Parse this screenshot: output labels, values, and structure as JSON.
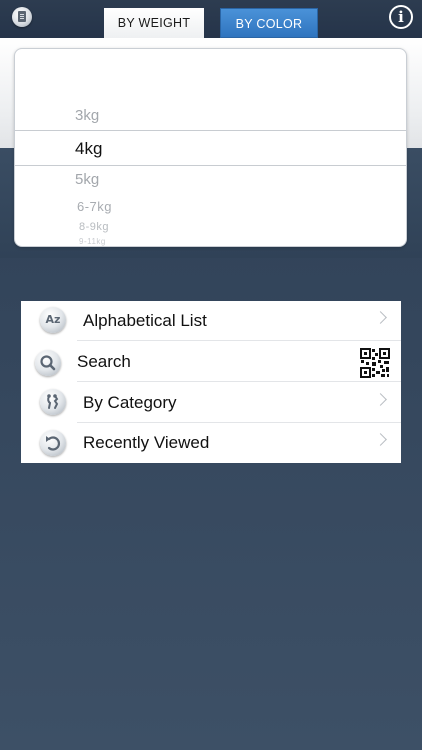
{
  "header": {
    "tabs": [
      {
        "label": "BY WEIGHT",
        "active": true
      },
      {
        "label": "BY COLOR",
        "active": false
      }
    ],
    "left_icon": "document-icon",
    "right_icon": "info-icon",
    "info_glyph": "i"
  },
  "picker": {
    "options": [
      "3kg",
      "4kg",
      "5kg",
      "6-7kg",
      "8-9kg",
      "9-11kg"
    ],
    "selected": "4kg"
  },
  "menu": {
    "items": [
      {
        "label": "Alphabetical List",
        "icon": "az-icon",
        "icon_text": "Az",
        "accessory": "chevron-right-icon"
      },
      {
        "label": "Search",
        "icon": "search-icon",
        "accessory": "qr-code-icon"
      },
      {
        "label": "By Category",
        "icon": "category-icon",
        "accessory": "chevron-right-icon"
      },
      {
        "label": "Recently Viewed",
        "icon": "history-icon",
        "accessory": "chevron-right-icon"
      }
    ]
  },
  "colors": {
    "tab_active_bg": "#ffffff",
    "tab_inactive_bg": "#3a84cf",
    "background_dark": "#34465c",
    "text_primary": "#111111",
    "text_faded": "#a3a7ac"
  }
}
